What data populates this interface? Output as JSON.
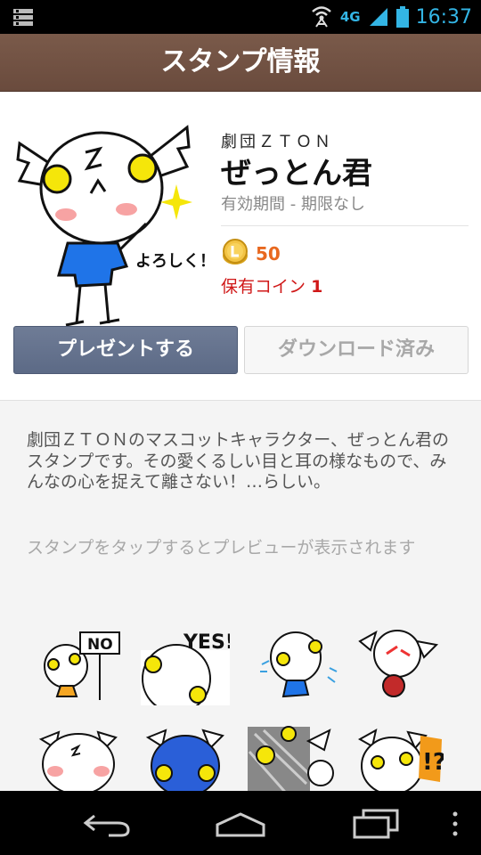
{
  "status_bar": {
    "network": "4G",
    "time": "16:37"
  },
  "header": {
    "title": "スタンプ情報"
  },
  "sticker": {
    "author": "劇団ＺＴＯＮ",
    "name": "ぜっとん君",
    "validity": "有効期間 - 期限なし",
    "price": "50",
    "owned_label": "保有コイン",
    "owned_value": "1",
    "main_image_text": "よろしく！"
  },
  "buttons": {
    "present": "プレゼントする",
    "download": "ダウンロード済み"
  },
  "description": "劇団ＺＴＯＮのマスコットキャラクター、ぜっとん君のスタンプです。その愛くるしい目と耳の様なもので、みんなの心を捉えて離さない！…らしい。",
  "preview_hint": "スタンプをタップするとプレビューが表示されます",
  "thumbnails": [
    {
      "text": "NO"
    },
    {
      "text": "YES!"
    },
    {
      "text": ""
    },
    {
      "text": ""
    },
    {
      "text": ""
    },
    {
      "text": ""
    },
    {
      "text": ""
    },
    {
      "text": "!?"
    }
  ],
  "colors": {
    "header": "#6f5042",
    "accent_price": "#e8681f",
    "owned": "#d01818",
    "button": "#62708c"
  }
}
